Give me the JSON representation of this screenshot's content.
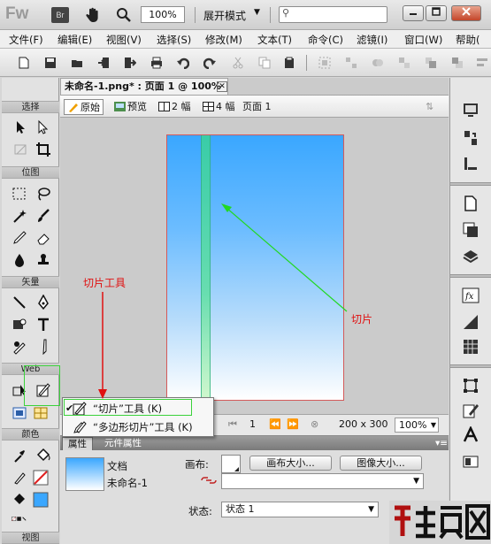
{
  "titlebar": {
    "app_logo": "Fw",
    "bridge_label": "Br",
    "zoom_value": "100%",
    "layout_mode": "展开模式",
    "search_placeholder": "",
    "window_buttons": [
      "minimize-icon",
      "restore-icon",
      "close-icon"
    ]
  },
  "menubar": {
    "items": [
      {
        "label": "文件(F)"
      },
      {
        "label": "编辑(E)"
      },
      {
        "label": "视图(V)"
      },
      {
        "label": "选择(S)"
      },
      {
        "label": "修改(M)"
      },
      {
        "label": "文本(T)"
      },
      {
        "label": "命令(C)"
      },
      {
        "label": "滤镜(I)"
      },
      {
        "label": "窗口(W)"
      },
      {
        "label": "帮助("
      }
    ]
  },
  "toolspanel": {
    "sections": {
      "select": "选择",
      "bitmap": "位图",
      "vector": "矢量",
      "web": "Web",
      "colors": "颜色",
      "view": "视图"
    }
  },
  "document": {
    "tab_title": "未命名-1.png* : 页面 1 @ 100%",
    "view_buttons": {
      "original": "原始",
      "preview": "预览",
      "two_up": "2 幅",
      "four_up": "4 幅",
      "page": "页面 1"
    },
    "status": {
      "page_number": "1",
      "canvas_size": "200 x 300",
      "zoom": "100%"
    }
  },
  "popup_menu": {
    "items": [
      {
        "label": "“切片”工具 (K)",
        "checked": true
      },
      {
        "label": "“多边形切片”工具 (K)",
        "checked": false
      }
    ]
  },
  "properties": {
    "tabs": [
      "属性",
      "元件属性"
    ],
    "doc_label": "文档",
    "doc_name": "未命名-1",
    "canvas_label": "画布:",
    "canvas_size_button": "画布大小...",
    "image_size_button": "图像大小...",
    "state_label": "状态:",
    "state_value": "状态 1"
  },
  "annotations": {
    "slice_tool": "切片工具",
    "slice": "切片"
  },
  "colors": {
    "annotation_red": "#e01010",
    "highlight_green": "#3bd23b",
    "canvas_top": "#3aa7ff",
    "slice_green": "#3ad39a"
  }
}
